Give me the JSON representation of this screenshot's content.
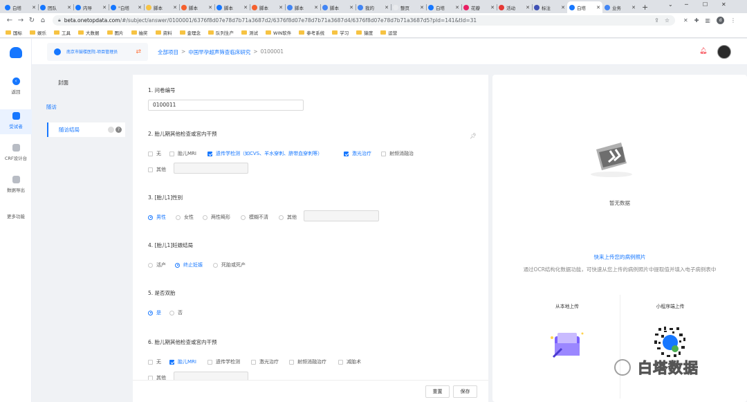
{
  "browser": {
    "tabs": [
      {
        "label": "白塔",
        "color": "#1677ff"
      },
      {
        "label": "团队",
        "color": "#1677ff"
      },
      {
        "label": "内导",
        "color": "#1677ff"
      },
      {
        "label": "\"白塔",
        "color": "#1677ff"
      },
      {
        "label": "脚本",
        "color": "#f6c343"
      },
      {
        "label": "脚本",
        "color": "#f5602d"
      },
      {
        "label": "脚本",
        "color": "#1677ff"
      },
      {
        "label": "脚本",
        "color": "#f5602d"
      },
      {
        "label": "脚本",
        "color": "#4285f4"
      },
      {
        "label": "脚本",
        "color": "#4285f4"
      },
      {
        "label": "我的",
        "color": "#4285f4"
      },
      {
        "label": "整页",
        "color": "#e8eaed"
      },
      {
        "label": "白塔",
        "color": "#1677ff"
      },
      {
        "label": "花瓣",
        "color": "#e91e63"
      },
      {
        "label": "活动",
        "color": "#e53935"
      },
      {
        "label": "标注",
        "color": "#3f51b5"
      },
      {
        "label": "白塔",
        "color": "#1677ff",
        "active": true
      },
      {
        "label": "业务",
        "color": "#4285f4"
      }
    ],
    "new_tab": "+",
    "url_host": "beta.onetopdata.com",
    "url_path": "/#/subject/answer/0100001/6376f8d07e78d7b71a3687d2/6376f8d07e78d7b71a3687d4/6376f8d07e78d7b71a3687d5?pId=141&tId=31",
    "profile_initial": "d",
    "bookmarks": [
      "国标",
      "娱乐",
      "工具",
      "大数据",
      "图片",
      "抽奖",
      "资料",
      "金理念",
      "队列生产",
      "测试",
      "WIN软件",
      "参考系统",
      "学习",
      "猿度",
      "运营"
    ]
  },
  "rail": {
    "items": [
      {
        "label": "返回"
      },
      {
        "label": "受试者",
        "active": true
      },
      {
        "label": "CRF设计台"
      },
      {
        "label": "数据导出"
      },
      {
        "label": "更多功能"
      }
    ]
  },
  "header": {
    "project_name": "南京市鼓楼医院-项目管理员",
    "breadcrumb": [
      "全部项目",
      "中国早孕超声筛查临床研究",
      "0100001"
    ]
  },
  "subnav": {
    "cover": "封面",
    "visit": "随访",
    "outcome": "随访结局"
  },
  "form": {
    "q1": {
      "title": "1. 问卷编号",
      "value": "0100011"
    },
    "q2": {
      "title": "2. 胎儿期其他检查或宫内干预",
      "options": [
        {
          "label": "无",
          "checked": false
        },
        {
          "label": "胎儿MRI",
          "checked": false
        },
        {
          "label": "遗传学检测（如CVS、羊水穿刺、脐带血穿刺等）",
          "checked": true
        },
        {
          "label": "激光治疗",
          "checked": true
        },
        {
          "label": "射频消融治",
          "checked": false
        },
        {
          "label": "其他",
          "checked": false
        }
      ]
    },
    "q3": {
      "title": "3. [胎儿1]性别",
      "options": [
        {
          "label": "男性",
          "checked": true
        },
        {
          "label": "女性",
          "checked": false
        },
        {
          "label": "两性畸形",
          "checked": false
        },
        {
          "label": "模糊不清",
          "checked": false
        },
        {
          "label": "其他",
          "checked": false
        }
      ]
    },
    "q4": {
      "title": "4. [胎儿1]妊娠结局",
      "options": [
        {
          "label": "活产",
          "checked": false
        },
        {
          "label": "终止妊娠",
          "checked": true
        },
        {
          "label": "死胎或死产",
          "checked": false
        }
      ]
    },
    "q5": {
      "title": "5. 是否双胎",
      "options": [
        {
          "label": "是",
          "checked": true
        },
        {
          "label": "否",
          "checked": false
        }
      ]
    },
    "q6": {
      "title": "6. 胎儿期其他检查或宫内干预",
      "options": [
        {
          "label": "无",
          "checked": false
        },
        {
          "label": "胎儿MRI",
          "checked": true
        },
        {
          "label": "遗传学检测",
          "checked": false
        },
        {
          "label": "激光治疗",
          "checked": false
        },
        {
          "label": "射频消融治疗",
          "checked": false
        },
        {
          "label": "减胎术",
          "checked": false
        },
        {
          "label": "其他",
          "checked": false
        }
      ]
    },
    "reset_label": "重置",
    "save_label": "保存"
  },
  "right": {
    "empty_text": "暂无数据",
    "ocr_title": "快来上传您的病例照片",
    "ocr_desc": "通过OCR结构化数据功能，可快速从您上传的病例照片中提取值并填入电子病例表中",
    "local_upload": "从本地上传",
    "mini_upload": "小程序端上传",
    "watermark": "白塔数据"
  },
  "colors": {
    "accent": "#1677ff",
    "bell": "#f5222d"
  }
}
